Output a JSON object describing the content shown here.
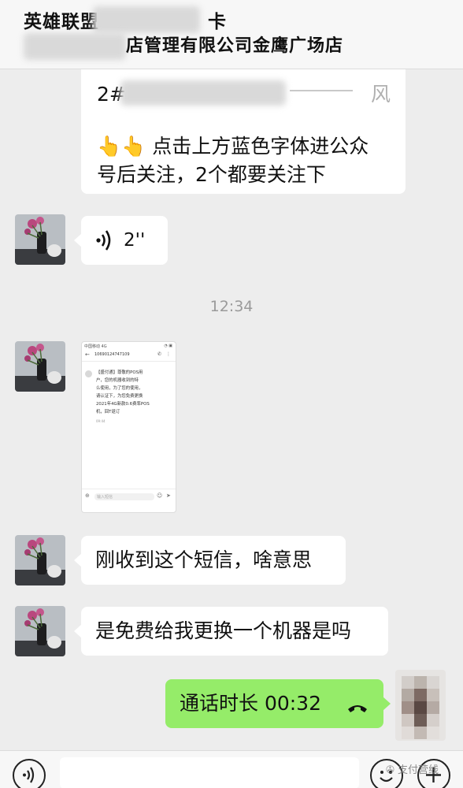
{
  "header": {
    "title_prefix": "英雄联盟",
    "title_suffix": "卡",
    "subtitle": "店管理有限公司金鹰广场店"
  },
  "messages": {
    "top_card_prefix": "2#",
    "top_card_suffix": "风",
    "top_card_emoji": "👆👆",
    "top_card_line1": "点击上方蓝色字体进公众",
    "top_card_line2": "号后关注，2个都要关注下",
    "voice_duration": "2''",
    "timestamp": "12:34",
    "msg_received_sms": "刚收到这个短信，啥意思",
    "msg_free_replace": "是免费给我更换一个机器是吗",
    "call_duration_label": "通话时长 00:32"
  },
  "sms_screenshot": {
    "status_left": "中国移动 4G",
    "status_right": "◔ ▣",
    "sender": "10690124747109",
    "body_lines": [
      "【盛付通】尊敬的POS用",
      "户，您的机器收到的特",
      "么使用，为了您的使用，",
      "请认证下，为您免费更换",
      "2021年4G新款0.6费率POS",
      "机，回T退订"
    ],
    "time": "09:44",
    "input_placeholder": "输入短信"
  },
  "watermark": {
    "text": "支付营线"
  },
  "colors": {
    "background": "#ededed",
    "bubble_left": "#ffffff",
    "bubble_right": "#95ec69"
  }
}
